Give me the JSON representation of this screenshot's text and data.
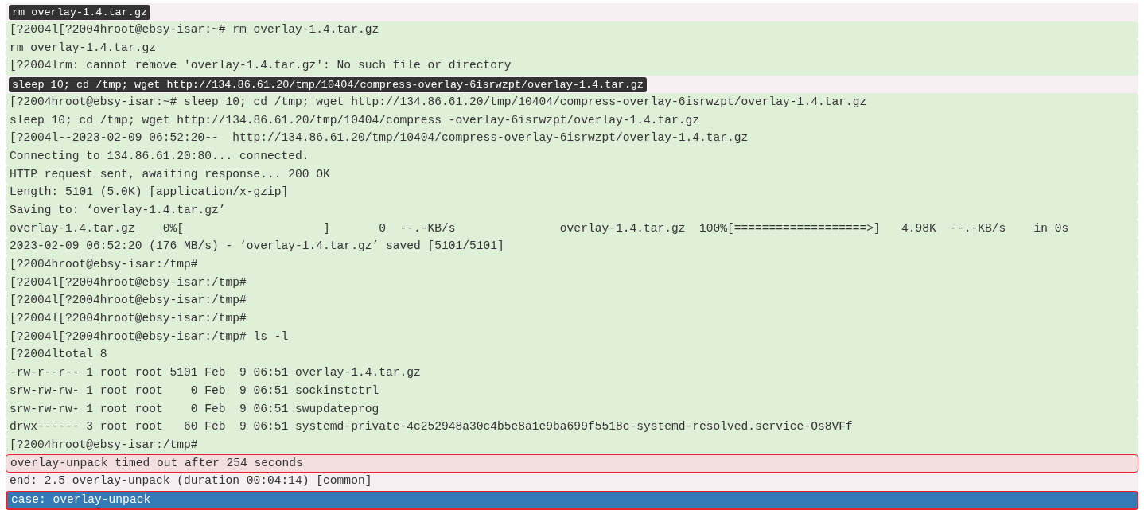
{
  "log_lines": [
    {
      "kind": "command",
      "text": "rm overlay-1.4.tar.gz"
    },
    {
      "kind": "output",
      "text": "[?2004l[?2004hroot@ebsy-isar:~# rm overlay-1.4.tar.gz"
    },
    {
      "kind": "output",
      "text": "rm overlay-1.4.tar.gz"
    },
    {
      "kind": "output",
      "text": "[?2004lrm: cannot remove 'overlay-1.4.tar.gz': No such file or directory"
    },
    {
      "kind": "command",
      "text": "sleep 10; cd /tmp; wget http://134.86.61.20/tmp/10404/compress-overlay-6isrwzpt/overlay-1.4.tar.gz"
    },
    {
      "kind": "output",
      "text": "[?2004hroot@ebsy-isar:~# sleep 10; cd /tmp; wget http://134.86.61.20/tmp/10404/compress-overlay-6isrwzpt/overlay-1.4.tar.gz"
    },
    {
      "kind": "output",
      "text": "sleep 10; cd /tmp; wget http://134.86.61.20/tmp/10404/compress -overlay-6isrwzpt/overlay-1.4.tar.gz"
    },
    {
      "kind": "output",
      "text": "[?2004l--2023-02-09 06:52:20--  http://134.86.61.20/tmp/10404/compress-overlay-6isrwzpt/overlay-1.4.tar.gz"
    },
    {
      "kind": "output",
      "text": "Connecting to 134.86.61.20:80... connected."
    },
    {
      "kind": "output",
      "text": "HTTP request sent, awaiting response... 200 OK"
    },
    {
      "kind": "output",
      "text": "Length: 5101 (5.0K) [application/x-gzip]"
    },
    {
      "kind": "output",
      "text": "Saving to: ‘overlay-1.4.tar.gz’"
    },
    {
      "kind": "output",
      "text": "overlay-1.4.tar.gz    0%[                    ]       0  --.-KB/s               overlay-1.4.tar.gz  100%[===================>]   4.98K  --.-KB/s    in 0s"
    },
    {
      "kind": "output",
      "text": "2023-02-09 06:52:20 (176 MB/s) - ‘overlay-1.4.tar.gz’ saved [5101/5101]"
    },
    {
      "kind": "output",
      "text": "[?2004hroot@ebsy-isar:/tmp#"
    },
    {
      "kind": "output",
      "text": "[?2004l[?2004hroot@ebsy-isar:/tmp#"
    },
    {
      "kind": "output",
      "text": "[?2004l[?2004hroot@ebsy-isar:/tmp#"
    },
    {
      "kind": "output",
      "text": "[?2004l[?2004hroot@ebsy-isar:/tmp#"
    },
    {
      "kind": "output",
      "text": "[?2004l[?2004hroot@ebsy-isar:/tmp# ls -l"
    },
    {
      "kind": "output",
      "text": "[?2004ltotal 8"
    },
    {
      "kind": "output",
      "text": "-rw-r--r-- 1 root root 5101 Feb  9 06:51 overlay-1.4.tar.gz"
    },
    {
      "kind": "output",
      "text": "srw-rw-rw- 1 root root    0 Feb  9 06:51 sockinstctrl"
    },
    {
      "kind": "output",
      "text": "srw-rw-rw- 1 root root    0 Feb  9 06:51 swupdateprog"
    },
    {
      "kind": "output",
      "text": "drwx------ 3 root root   60 Feb  9 06:51 systemd-private-4c252948a30c4b5e8a1e9ba699f5518c-systemd-resolved.service-Os8VFf"
    },
    {
      "kind": "output",
      "text": "[?2004hroot@ebsy-isar:/tmp#"
    },
    {
      "kind": "error",
      "text": "overlay-unpack timed out after 254 seconds"
    },
    {
      "kind": "info",
      "text": "end: 2.5 overlay-unpack (duration 00:04:14) [common]"
    },
    {
      "kind": "case",
      "text": "case: overlay-unpack"
    }
  ]
}
